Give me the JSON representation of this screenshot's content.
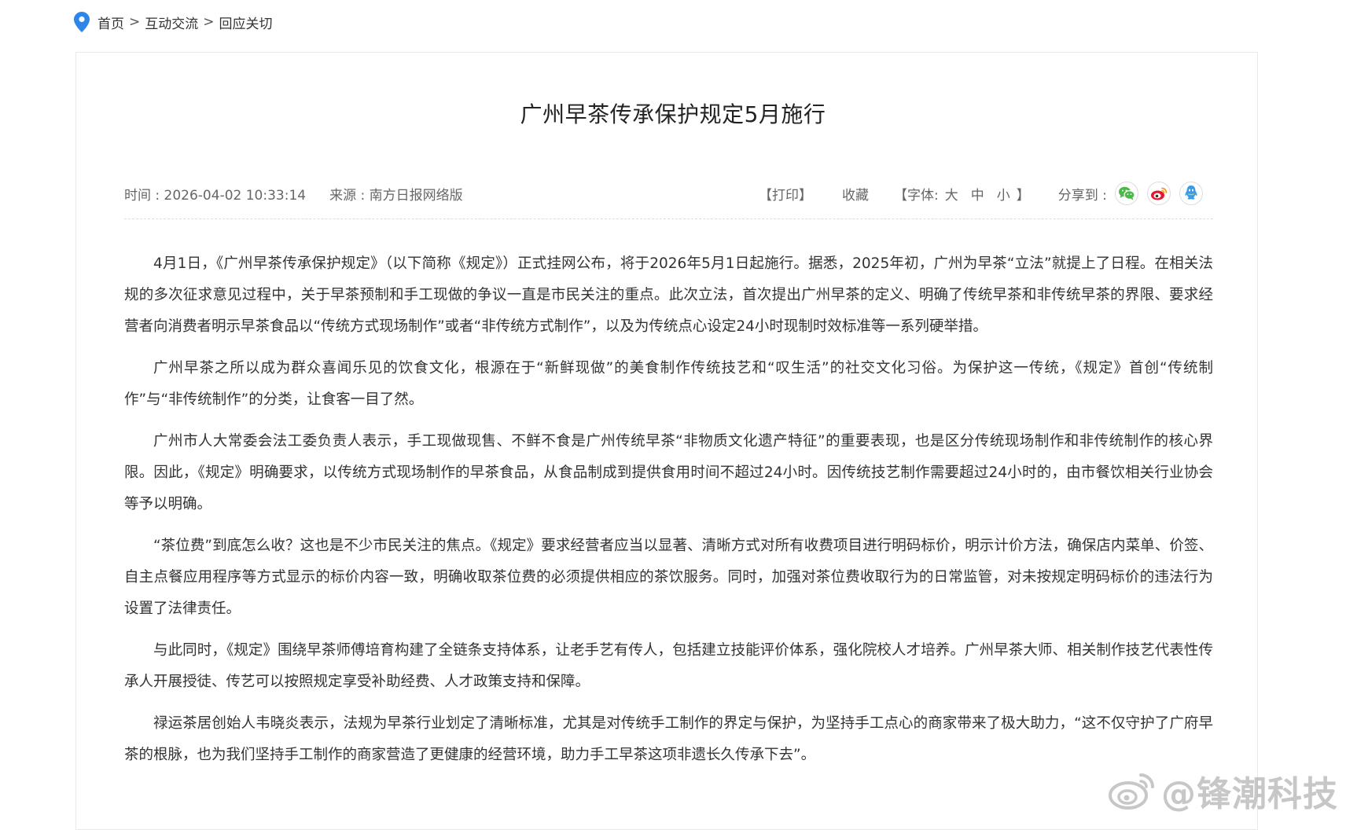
{
  "breadcrumb": {
    "home": "首页",
    "separator": ">",
    "section": "互动交流",
    "current": "回应关切"
  },
  "article": {
    "title": "广州早茶传承保护规定5月施行",
    "time": "时间 : 2026-04-02 10:33:14",
    "source": "来源 : 南方日报网络版",
    "paragraphs": [
      "4月1日，《广州早茶传承保护规定》（以下简称《规定》）正式挂网公布，将于2026年5月1日起施行。据悉，2025年初，广州为早茶“立法”就提上了日程。在相关法规的多次征求意见过程中，关于早茶预制和手工现做的争议一直是市民关注的重点。此次立法，首次提出广州早茶的定义、明确了传统早茶和非传统早茶的界限、要求经营者向消费者明示早茶食品以“传统方式现场制作”或者“非传统方式制作”，以及为传统点心设定24小时现制时效标准等一系列硬举措。",
      "广州早茶之所以成为群众喜闻乐见的饮食文化，根源在于“新鲜现做”的美食制作传统技艺和“叹生活”的社交文化习俗。为保护这一传统，《规定》首创“传统制作”与“非传统制作”的分类，让食客一目了然。",
      "广州市人大常委会法工委负责人表示，手工现做现售、不鲜不食是广州传统早茶“非物质文化遗产特征”的重要表现，也是区分传统现场制作和非传统制作的核心界限。因此，《规定》明确要求，以传统方式现场制作的早茶食品，从食品制成到提供食用时间不超过24小时。因传统技艺制作需要超过24小时的，由市餐饮相关行业协会等予以明确。",
      "“茶位费”到底怎么收？这也是不少市民关注的焦点。《规定》要求经营者应当以显著、清晰方式对所有收费项目进行明码标价，明示计价方法，确保店内菜单、价签、自主点餐应用程序等方式显示的标价内容一致，明确收取茶位费的必须提供相应的茶饮服务。同时，加强对茶位费收取行为的日常监管，对未按规定明码标价的违法行为设置了法律责任。",
      "与此同时，《规定》围绕早茶师傅培育构建了全链条支持体系，让老手艺有传人，包括建立技能评价体系，强化院校人才培养。广州早茶大师、相关制作技艺代表性传承人开展授徒、传艺可以按照规定享受补助经费、人才政策支持和保障。",
      "禄运茶居创始人韦晓炎表示，法规为早茶行业划定了清晰标准，尤其是对传统手工制作的界定与保护，为坚持手工点心的商家带来了极大助力，“这不仅守护了广府早茶的根脉，也为我们坚持手工制作的商家营造了更健康的经营环境，助力手工早茶这项非遗长久传承下去”。"
    ]
  },
  "tools": {
    "print": "【打印】",
    "favorite": "收藏",
    "font_open": "【字体:",
    "font_large": "大",
    "font_medium": "中",
    "font_small": "小",
    "font_close": "】",
    "share_label": "分享到 :"
  },
  "share_icons": [
    "wechat-icon",
    "weibo-icon",
    "qq-icon"
  ],
  "watermark": {
    "text": "@锋潮科技"
  },
  "colors": {
    "wechat": "#4cb848",
    "weibo": "#e6162d",
    "qq": "#3a9be9",
    "pin": "#2f86e8"
  }
}
